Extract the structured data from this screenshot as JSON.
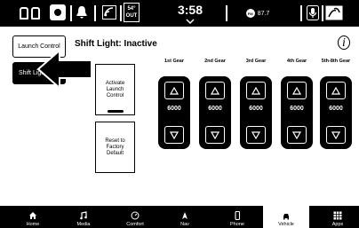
{
  "status_bar": {
    "outside_temp_value": "54°",
    "outside_temp_label": "OUT",
    "time": "3:58",
    "radio_band": "FM",
    "radio_station": "87.7",
    "icons": [
      "seat-heat-icon",
      "steering-heat-icon",
      "notification-bell-icon",
      "wifi-icon",
      "microphone-icon",
      "climate-icon"
    ]
  },
  "menu": {
    "launch_control_label": "Launch Control",
    "shift_light_label": "Shift Light"
  },
  "page": {
    "title": "Shift Light: Inactive",
    "info_symbol": "i"
  },
  "actions": {
    "activate_label": "Activate Launch Control",
    "reset_label": "Reset to Factory Default"
  },
  "gears": [
    {
      "label": "1st Gear",
      "value": "6000"
    },
    {
      "label": "2nd Gear",
      "value": "6000"
    },
    {
      "label": "3rd Gear",
      "value": "6000"
    },
    {
      "label": "4th Gear",
      "value": "6000"
    },
    {
      "label": "5th-8th Gear",
      "value": "6000"
    }
  ],
  "bottom_nav": [
    {
      "label": "Home",
      "icon": "home-icon"
    },
    {
      "label": "Media",
      "icon": "music-note-icon"
    },
    {
      "label": "Comfort",
      "icon": "climate-icon"
    },
    {
      "label": "Nav",
      "icon": "navigation-arrow-icon"
    },
    {
      "label": "Phone",
      "icon": "phone-icon"
    },
    {
      "label": "Vehicle",
      "icon": "car-icon"
    },
    {
      "label": "Apps",
      "icon": "apps-grid-icon"
    }
  ],
  "active_nav": "Vehicle",
  "colors": {
    "background": "#ffffff",
    "bars": "#000000",
    "selected_menu": "#000000"
  }
}
